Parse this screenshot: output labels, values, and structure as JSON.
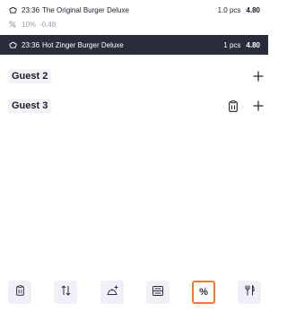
{
  "order_items": [
    {
      "time": "23:36",
      "name": "The Original Burger Deluxe",
      "qty": "1.0 pcs",
      "price": "4.80",
      "icon": "chef-hat-icon"
    },
    {
      "time": "23:36",
      "name": "Hot Zinger Burger Deluxe",
      "qty": "1 pcs",
      "price": "4.80",
      "icon": "chef-hat-icon",
      "selected": true
    }
  ],
  "discount": {
    "percent": "10%",
    "amount": "-0.48",
    "icon": "percent-icon"
  },
  "guests": [
    {
      "label": "Guest 2",
      "actions": [
        "add-icon"
      ]
    },
    {
      "label": "Guest 3",
      "actions": [
        "clipboard-icon",
        "add-icon"
      ]
    }
  ],
  "toolbar": {
    "items": [
      "clipboard-icon",
      "sort-arrows-icon",
      "cloche-add-icon",
      "split-icon",
      "percent-icon",
      "cutlery-icon"
    ],
    "active": "percent-icon",
    "percent_glyph": "%"
  },
  "colors": {
    "selected_row": "#2a2d39",
    "accent": "#f07a35",
    "button_bg": "#f0f0f8"
  }
}
